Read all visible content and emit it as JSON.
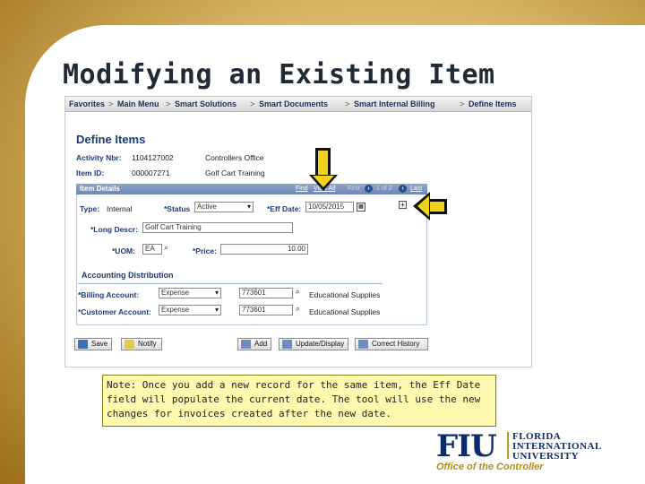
{
  "slide": {
    "title": "Modifying an Existing Item"
  },
  "nav": {
    "items": [
      "Favorites",
      "Main Menu",
      "Smart Solutions",
      "Smart Documents",
      "Smart Internal Billing",
      "Define Items"
    ],
    "separator": ">"
  },
  "form": {
    "page_title": "Define Items",
    "activity_label": "Activity Nbr:",
    "activity_value": "1104127002",
    "activity_desc": "Controllers Office",
    "item_label": "Item ID:",
    "item_value": "000007271",
    "item_desc": "Golf Cart Training",
    "section": {
      "title": "Item Details",
      "find": "Find",
      "view_all": "View All",
      "first": "First",
      "pager": "1 of 2",
      "last": "Last"
    },
    "type_label": "Type:",
    "type_value": "Internal",
    "status_label": "*Status",
    "status_value": "Active",
    "eff_date_label": "*Eff Date:",
    "eff_date_value": "10/05/2015",
    "long_descr_label": "*Long Descr:",
    "long_descr_value": "Golf Cart Training",
    "uom_label": "*UOM:",
    "uom_value": "EA",
    "price_label": "*Price:",
    "price_value": "10.00",
    "accounting_title": "Accounting Distribution",
    "billing_label": "*Billing Account:",
    "billing_type": "Expense",
    "billing_account": "773601",
    "billing_desc": "Educational Supplies",
    "customer_label": "*Customer Account:",
    "customer_type": "Expense",
    "customer_account": "773601",
    "customer_desc": "Educational Supplies"
  },
  "buttons": {
    "save": "Save",
    "notify": "Notify",
    "add": "Add",
    "update_display": "Update/Display",
    "correct_history": "Correct History"
  },
  "note": "Note: Once you add a new record for the same item, the Eff Date field will populate the current date. The tool will use the new changes for invoices created after the new date.",
  "logo": {
    "mark": "FIU",
    "line1": "FLORIDA",
    "line2": "INTERNATIONAL",
    "line3": "UNIVERSITY",
    "office": "Office of the Controller"
  },
  "colors": {
    "arrow_fill": "#f1d21a",
    "note_bg": "#fff9b0",
    "brand_blue": "#0b2b6b",
    "brand_gold": "#b08d1e"
  }
}
